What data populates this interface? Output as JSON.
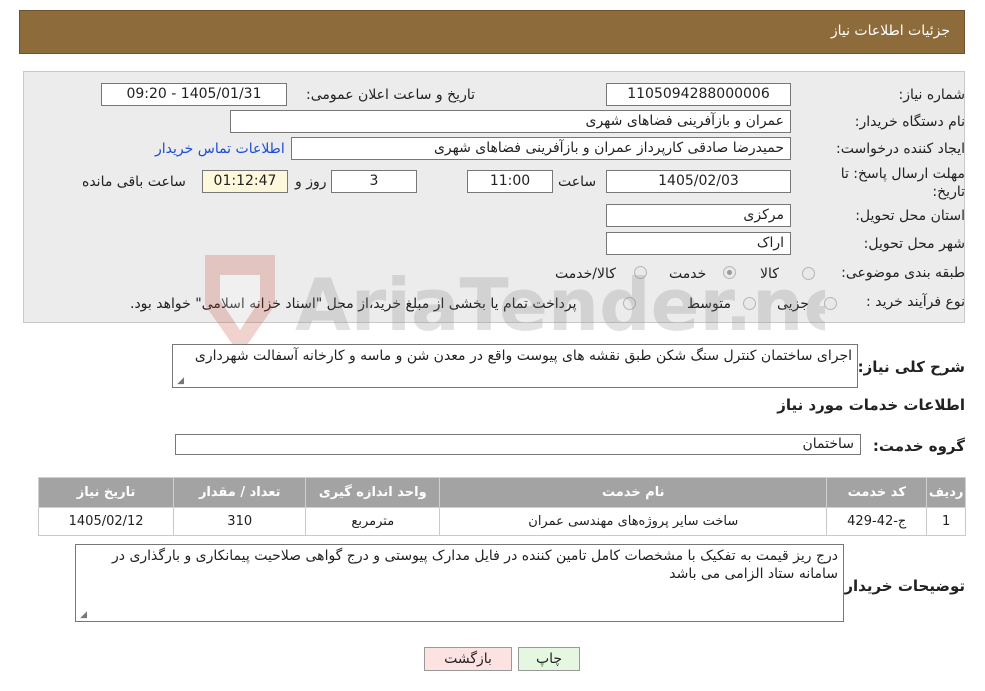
{
  "header": {
    "title": "جزئیات اطلاعات نیاز"
  },
  "form": {
    "need_number_label": "شماره نیاز:",
    "need_number": "1105094288000006",
    "announce_label": "تاریخ و ساعت اعلان عمومی:",
    "announce_value": "1405/01/31 - 09:20",
    "buyer_org_label": "نام دستگاه خریدار:",
    "buyer_org": "عمران و بازآفرینی فضاهای شهری",
    "creator_label": "ایجاد کننده درخواست:",
    "creator": "حمیدرضا    صادقی  کارپرداز  عمران و بازآفرینی فضاهای شهری",
    "contact_link": "اطلاعات تماس خریدار",
    "deadline_label": "مهلت ارسال پاسخ: تا تاریخ:",
    "deadline_date": "1405/02/03",
    "time_label": "ساعت",
    "deadline_time": "11:00",
    "days_value": "3",
    "days_label": "روز و",
    "remaining_value": "01:12:47",
    "remaining_label": "ساعت باقی مانده",
    "province_label": "استان محل تحویل:",
    "province": "مرکزی",
    "city_label": "شهر محل تحویل:",
    "city": "اراک",
    "category_label": "طبقه بندی موضوعی:",
    "category_options": [
      "کالا",
      "خدمت",
      "کالا/خدمت"
    ],
    "category_selected": "خدمت",
    "purchase_type_label": "نوع فرآیند خرید :",
    "purchase_options": [
      "جزیی",
      "متوسط"
    ],
    "purchase_note": "پرداخت تمام یا بخشی از مبلغ خرید،از محل \"اسناد خزانه اسلامی\" خواهد بود."
  },
  "summary": {
    "label": "شرح کلی نیاز:",
    "text": "اجرای ساختمان کنترل سنگ شکن طبق نقشه های پیوست واقع در معدن شن و ماسه و کارخانه آسفالت شهرداری"
  },
  "services": {
    "section_title": "اطلاعات خدمات مورد نیاز",
    "group_label": "گروه خدمت:",
    "group_value": "ساختمان",
    "columns": [
      "ردیف",
      "کد خدمت",
      "نام خدمت",
      "واحد اندازه گیری",
      "تعداد / مقدار",
      "تاریخ نیاز"
    ],
    "rows": [
      [
        "1",
        "ج-42-429",
        "ساخت سایر پروژه‌های مهندسی عمران",
        "مترمربع",
        "310",
        "1405/02/12"
      ]
    ]
  },
  "buyer_notes": {
    "label": "توضیحات خریدار:",
    "text": "درج ریز قیمت به تفکیک با مشخصات کامل تامین کننده در فایل مدارک پیوستی و درج گواهی صلاحیت پیمانکاری و بارگذاری در سامانه ستاد الزامی می باشد"
  },
  "buttons": {
    "print": "چاپ",
    "back": "بازگشت"
  },
  "watermark": {
    "text": "AriaTender.neT"
  },
  "colors": {
    "header": "#8d6b3b",
    "table_header": "#a3a3a3",
    "link": "#1a4cd8",
    "back_button": "#fde2e2",
    "print_button": "#e5f7e0"
  }
}
